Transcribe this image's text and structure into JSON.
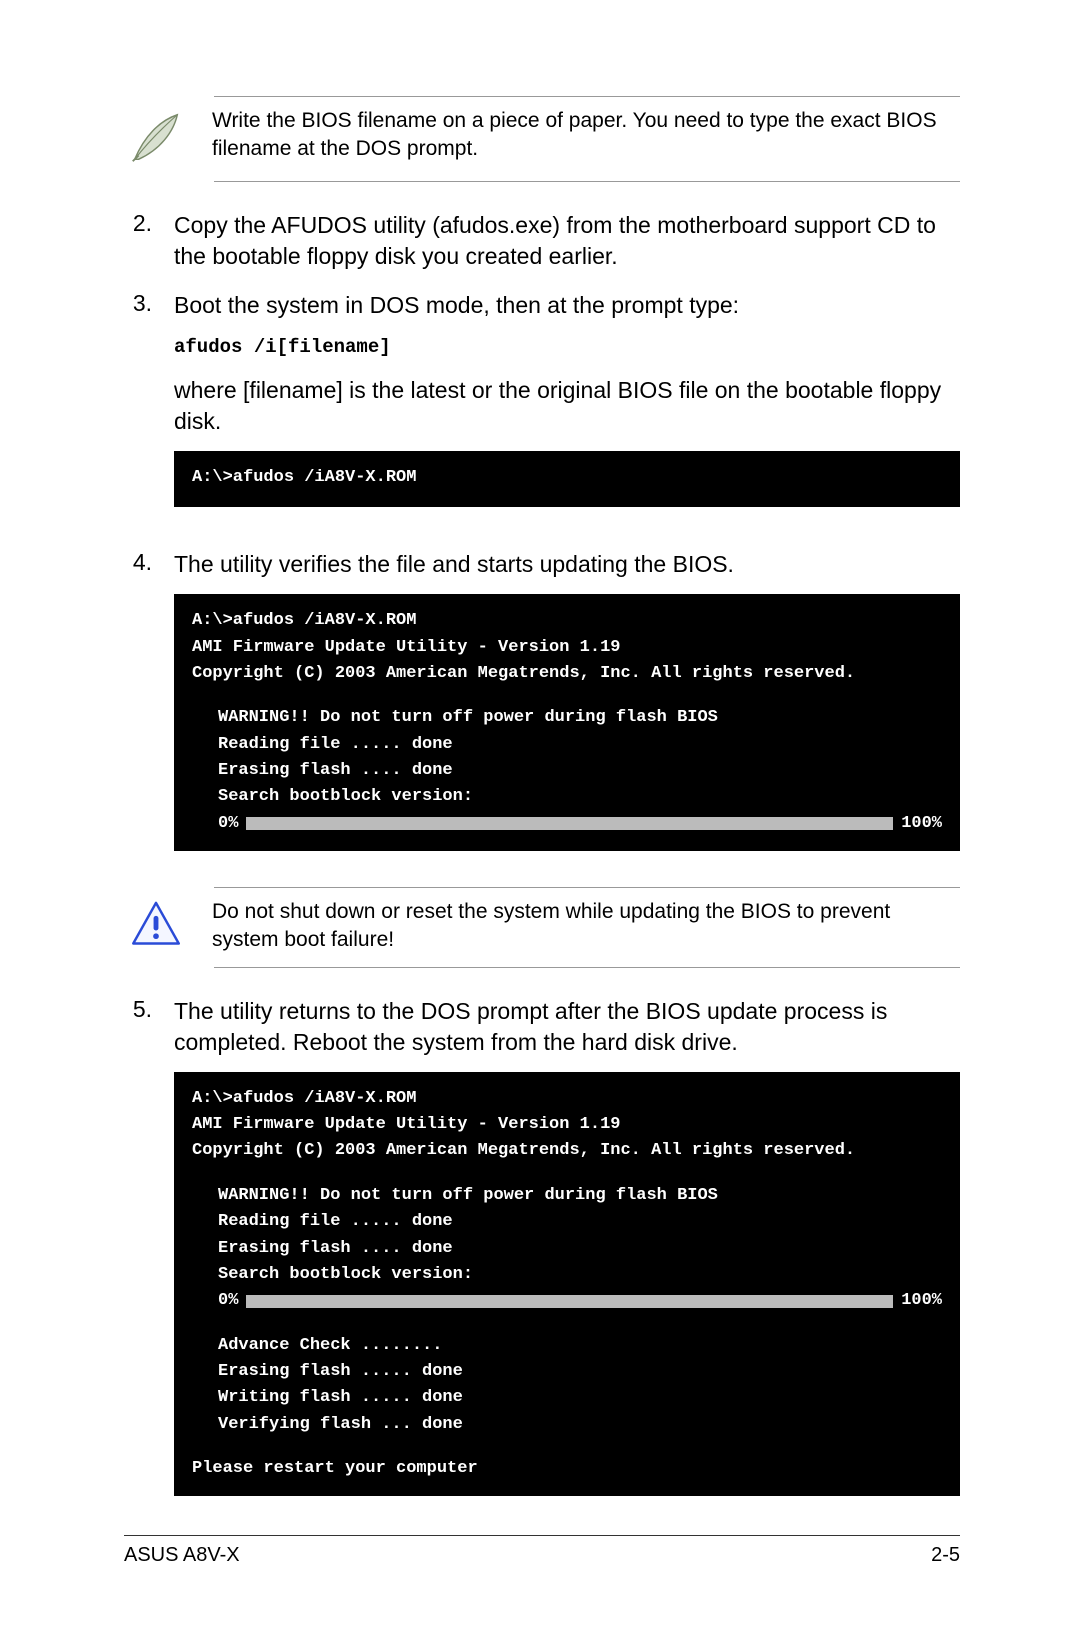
{
  "note": {
    "text": "Write the BIOS filename on a piece of paper. You need to type the exact BIOS filename at the DOS prompt."
  },
  "steps": {
    "s2": {
      "num": "2.",
      "text": "Copy the AFUDOS utility (afudos.exe) from the motherboard support CD to the bootable floppy disk you created earlier."
    },
    "s3": {
      "num": "3.",
      "text": "Boot the system in DOS mode, then at the prompt type:",
      "cmd": "afudos /i[filename]",
      "after": "where [filename] is the latest or the original BIOS file on the bootable floppy disk."
    },
    "s4": {
      "num": "4.",
      "text": "The utility verifies the file and starts updating the BIOS."
    },
    "s5": {
      "num": "5.",
      "text": "The utility returns to the DOS prompt after the BIOS update process is completed. Reboot the system from the hard disk drive."
    }
  },
  "term1": {
    "l1": "A:\\>afudos /iA8V-X.ROM"
  },
  "term2": {
    "l1": "A:\\>afudos /iA8V-X.ROM",
    "l2": "AMI Firmware Update Utility - Version 1.19",
    "l3": "Copyright (C) 2003 American Megatrends, Inc. All rights reserved.",
    "w": "WARNING!! Do not turn off power during flash BIOS",
    "r": "Reading file ..... done",
    "e": "Erasing flash .... done",
    "s": "Search bootblock version:",
    "p0": "0%",
    "p100": "100%"
  },
  "warning": {
    "text": "Do not shut down or reset the system while updating the BIOS to prevent system boot failure!"
  },
  "term3": {
    "l1": "A:\\>afudos /iA8V-X.ROM",
    "l2": "AMI Firmware Update Utility - Version 1.19",
    "l3": "Copyright (C) 2003 American Megatrends, Inc. All rights reserved.",
    "w": "WARNING!! Do not turn off power during flash BIOS",
    "r": "Reading file ..... done",
    "e": "Erasing flash .... done",
    "s": "Search bootblock version:",
    "p0": "0%",
    "p100": "100%",
    "a": "Advance Check ........",
    "e2": "Erasing flash ..... done",
    "wr": "Writing flash ..... done",
    "v": "Verifying flash ... done",
    "restart": "Please restart your computer"
  },
  "footer": {
    "left": "ASUS A8V-X",
    "right": "2-5"
  }
}
